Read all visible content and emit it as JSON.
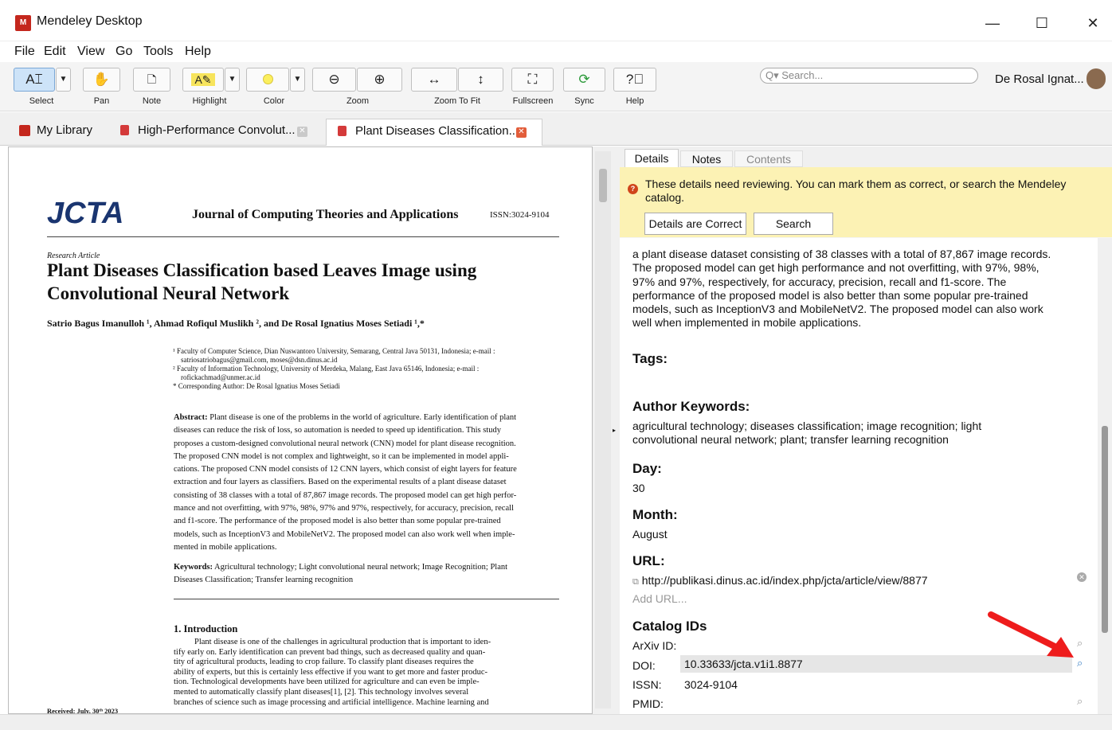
{
  "window": {
    "logo_text": "M",
    "title": "Mendeley Desktop",
    "minimize": "—",
    "maximize": "☐",
    "close": "✕"
  },
  "menu": [
    "File",
    "Edit",
    "View",
    "Go",
    "Tools",
    "Help"
  ],
  "toolbar": {
    "select": "Select",
    "pan": "Pan",
    "note": "Note",
    "highlight": "Highlight",
    "color": "Color",
    "zoom": "Zoom",
    "zoom_to_fit": "Zoom To Fit",
    "fullscreen": "Fullscreen",
    "sync": "Sync",
    "help": "Help"
  },
  "search": {
    "placeholder": "Q▾ Search..."
  },
  "user": {
    "name": "De Rosal Ignat..."
  },
  "tabs": [
    {
      "label": "My Library"
    },
    {
      "label": "High-Performance Convolut..."
    },
    {
      "label": "Plant Diseases Classification..."
    }
  ],
  "pdf": {
    "logo": "JCTA",
    "journal": "Journal of Computing Theories and Applications",
    "issn": "ISSN:3024-9104",
    "article_type": "Research Article",
    "title_line1": "Plant Diseases Classification based Leaves Image using",
    "title_line2": "Convolutional Neural Network",
    "authors": "Satrio Bagus Imanulloh ¹, Ahmad Rofiqul Muslikh ², and De Rosal Ignatius Moses Setiadi ¹,*",
    "aff": [
      "¹ Faculty of Computer Science, Dian Nuswantoro University, Semarang, Central Java 50131, Indonesia; e-mail :",
      "satriosatriobagus@gmail.com, moses@dsn.dinus.ac.id",
      "² Faculty of Information Technology, University of Merdeka, Malang, East Java 65146, Indonesia; e-mail :",
      "rofickachmad@unmer.ac.id",
      "* Corresponding Author: De Rosal Ignatius Moses Setiadi"
    ],
    "abstract_label": "Abstract:",
    "abstract": [
      "Plant disease is one of the problems in the world of agriculture. Early identification of plant",
      "diseases can reduce the risk of loss, so automation is needed to speed up identification. This study",
      "proposes a custom-designed convolutional neural network (CNN) model for plant disease recognition.",
      "The proposed CNN model is not complex and lightweight, so it can be implemented in model appli-",
      "cations. The proposed CNN model consists of 12 CNN layers, which consist of eight layers for feature",
      "extraction and four layers as classifiers. Based on the experimental results of a plant disease dataset",
      "consisting of 38 classes with a total of 87,867 image records. The proposed model can get high perfor-",
      "mance and not overfitting, with 97%, 98%, 97% and 97%, respectively, for accuracy, precision, recall",
      "and f1-score. The performance of the proposed model is also better than some popular pre-trained",
      "models, such as InceptionV3 and MobileNetV2. The proposed model can also work well when imple-",
      "mented in mobile applications."
    ],
    "keywords_label": "Keywords:",
    "keywords_l1": "Agricultural technology; Light convolutional neural network; Image Recognition; Plant",
    "keywords_l2": "Diseases Classification; Transfer learning recognition",
    "intro_heading": "1. Introduction",
    "intro": [
      "Plant disease is one of the challenges in agricultural production that is important to iden-",
      "tify early on. Early identification can prevent bad things, such as decreased quality and quan-",
      "tity of agricultural products, leading to crop failure. To classify plant diseases requires the",
      "ability of experts, but this is certainly less effective if you want to get more and faster produc-",
      "tion. Technological developments have been utilized for agriculture and can even be imple-",
      "mented to automatically classify plant diseases[1], [2]. This technology involves several",
      "branches of science such as image processing and artificial intelligence. Machine learning and"
    ],
    "received": "Received: July, 30ᵗʰ 2023"
  },
  "details": {
    "tabs": [
      "Details",
      "Notes",
      "Contents"
    ],
    "warning": "These details need reviewing. You can mark them as correct, or search the Mendeley catalog.",
    "btn_correct": "Details are Correct",
    "btn_search": "Search",
    "abstract_lines": [
      "a plant disease dataset consisting of 38 classes with a total of 87,867 image records.",
      "The proposed model can get high performance and not overfitting, with 97%, 98%,",
      "97% and 97%, respectively, for accuracy, precision, recall and f1-score. The",
      "performance of the proposed model is also better than some popular pre-trained",
      "models, such as InceptionV3 and MobileNetV2. The proposed model can also work",
      "well when implemented in mobile applications."
    ],
    "tags_label": "Tags:",
    "kw_label": "Author Keywords:",
    "kw_l1": "agricultural technology; diseases classification; image recognition; light",
    "kw_l2": "convolutional neural network; plant; transfer learning recognition",
    "day_label": "Day:",
    "day": "30",
    "month_label": "Month:",
    "month": "August",
    "url_label": "URL:",
    "url": "http://publikasi.dinus.ac.id/index.php/jcta/article/view/8877",
    "add_url": "Add URL...",
    "catalog_label": "Catalog IDs",
    "arxiv_label": "ArXiv ID:",
    "doi_label": "DOI:",
    "doi": "10.33633/jcta.v1i1.8877",
    "issn_label": "ISSN:",
    "issn": "3024-9104",
    "pmid_label": "PMID:"
  }
}
